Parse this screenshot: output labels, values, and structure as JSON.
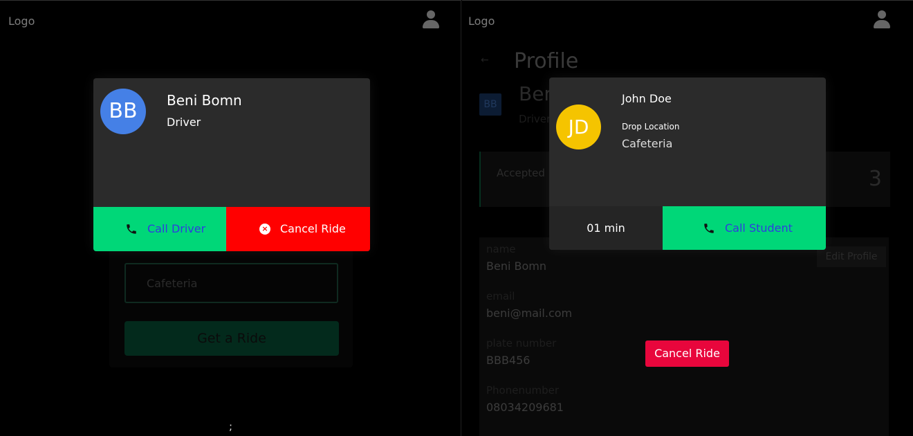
{
  "left": {
    "logo": "Logo",
    "background": {
      "location_value": "Cafeteria",
      "ride_button": "Get a Ride",
      "stray_text": ";"
    },
    "modal": {
      "avatar_initials": "BB",
      "name": "Beni Bomn",
      "role": "Driver",
      "call_label": "Call Driver",
      "cancel_label": "Cancel Ride"
    }
  },
  "right": {
    "logo": "Logo",
    "background": {
      "back_arrow": "←",
      "title": "Profile",
      "avatar_initials": "BB",
      "name": "Beni Bomn",
      "role": "Driver",
      "stat_label": "Accepted",
      "stat_value": "3",
      "edit_button": "Edit Profile",
      "fields": [
        {
          "label": "name",
          "value": "Beni Bomn"
        },
        {
          "label": "email",
          "value": "beni@mail.com"
        },
        {
          "label": "plate number",
          "value": "BBB456"
        },
        {
          "label": "Phonenumber",
          "value": "08034209681"
        }
      ]
    },
    "modal": {
      "avatar_initials": "JD",
      "name": "John Doe",
      "drop_label": "Drop Location",
      "drop_value": "Cafeteria",
      "eta": "01 min",
      "call_label": "Call Student"
    },
    "cancel_button": "Cancel Ride"
  },
  "colors": {
    "green": "#00d778",
    "red": "#ff0000",
    "cancel_red": "#e8063c",
    "avatar_blue": "#4580e6",
    "avatar_yellow": "#f5c400",
    "link_blue": "#2f3ce0"
  }
}
